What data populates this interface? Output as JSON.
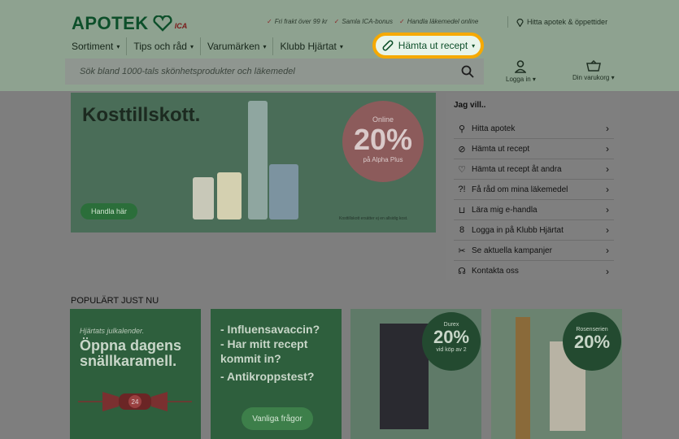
{
  "header": {
    "logo": "APOTEK",
    "logo_sub": "ICA",
    "usps": [
      "Fri frakt över 99 kr",
      "Samla ICA-bonus",
      "Handla läkemedel online"
    ],
    "find_pharmacy": "Hitta apotek & öppettider",
    "nav": [
      "Sortiment",
      "Tips och råd",
      "Varumärken",
      "Klubb Hjärtat"
    ],
    "highlighted_nav": "Hämta ut recept",
    "search_placeholder": "Sök bland 1000-tals skönhetsprodukter och läkemedel",
    "login_label": "Logga in",
    "cart_label": "Din varukorg"
  },
  "hero": {
    "title": "Kosttillskott.",
    "circle_top": "Online",
    "circle_value": "20%",
    "circle_bottom": "på Alpha Plus",
    "button": "Handla här",
    "disclaimer": "Kosttillskott ersätter ej en allsidig kost."
  },
  "side_menu": {
    "title": "Jag vill..",
    "items": [
      {
        "label": "Hitta apotek",
        "icon": "location-pin-icon"
      },
      {
        "label": "Hämta ut recept",
        "icon": "pill-icon"
      },
      {
        "label": "Hämta ut recept åt andra",
        "icon": "heart-icon"
      },
      {
        "label": "Få råd om mina läkemedel",
        "icon": "question-icon"
      },
      {
        "label": "Lära mig e-handla",
        "icon": "basket-icon"
      },
      {
        "label": "Logga in på Klubb Hjärtat",
        "icon": "user-icon"
      },
      {
        "label": "Se aktuella kampanjer",
        "icon": "scissors-icon"
      },
      {
        "label": "Kontakta oss",
        "icon": "headset-icon"
      }
    ]
  },
  "popular": {
    "title": "POPULÄRT JUST NU",
    "card1": {
      "top": "Hjärtats julkalender.",
      "big": "Öppna dagens snällkaramell.",
      "number": "24"
    },
    "card2": {
      "lines": [
        "- Influensavaccin?",
        "- Har mitt recept kommit in?",
        "- Antikroppstest?"
      ],
      "button": "Vanliga frågor"
    },
    "card3": {
      "brand": "Durex",
      "value": "20%",
      "sub": "vid köp av 2"
    },
    "card4": {
      "brand": "Rosenserien",
      "value": "20%"
    }
  }
}
